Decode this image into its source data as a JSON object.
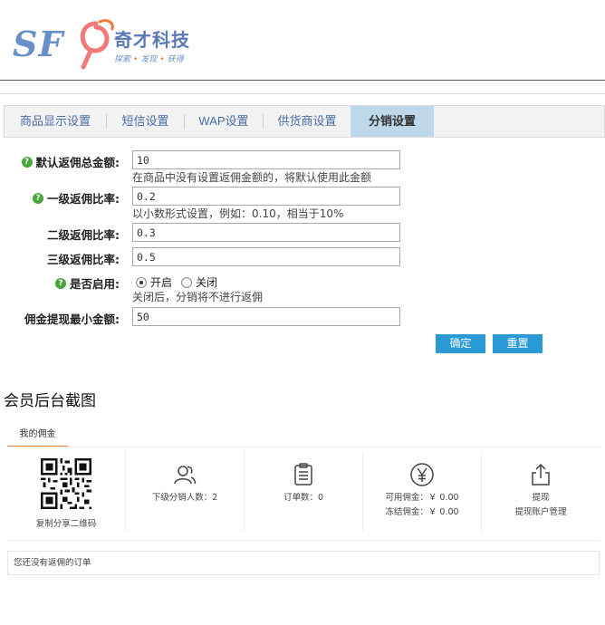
{
  "logo": {
    "letters": "SF",
    "name": "奇才科技",
    "slogan": [
      "探索",
      "发现",
      "获得"
    ]
  },
  "tabs": [
    {
      "label": "商品显示设置",
      "active": false
    },
    {
      "label": "短信设置",
      "active": false
    },
    {
      "label": "WAP设置",
      "active": false
    },
    {
      "label": "供货商设置",
      "active": false
    },
    {
      "label": "分销设置",
      "active": true
    }
  ],
  "form": {
    "default_total": {
      "label": "默认返佣总金额:",
      "value": "10",
      "hint": "在商品中没有设置返佣金额的，将默认使用此金额"
    },
    "level1_rate": {
      "label": "一级返佣比率:",
      "value": "0.2",
      "hint": "以小数形式设置，例如：0.10，相当于10%"
    },
    "level2_rate": {
      "label": "二级返佣比率:",
      "value": "0.3"
    },
    "level3_rate": {
      "label": "三级返佣比率:",
      "value": "0.5"
    },
    "enabled": {
      "label": "是否启用:",
      "on_label": "开启",
      "off_label": "关闭",
      "selected": "开启",
      "hint": "关闭后，分销将不进行返佣"
    },
    "min_withdraw": {
      "label": "佣金提现最小金额:",
      "value": "50"
    },
    "confirm_label": "确定",
    "reset_label": "重置"
  },
  "member": {
    "section_title": "会员后台截图",
    "tab_label": "我的佣金",
    "qr_caption": "复制分享二维码",
    "subordinates": "下级分销人数：2",
    "orders": "订单数：0",
    "available": "可用佣金：￥ 0.00",
    "frozen": "冻结佣金：￥ 0.00",
    "withdraw": "提现",
    "withdraw_account": "提现账户管理",
    "empty_text": "您还没有返佣的订单"
  },
  "colors": {
    "accent": "#2a9ad6",
    "active_tab": "#bcd8ea",
    "help_icon": "#4aa63a",
    "tab_underline": "#f08a3a"
  },
  "icons": [
    "help-icon",
    "qr-code-icon",
    "users-icon",
    "clipboard-icon",
    "yen-circle-icon",
    "share-upload-icon"
  ]
}
